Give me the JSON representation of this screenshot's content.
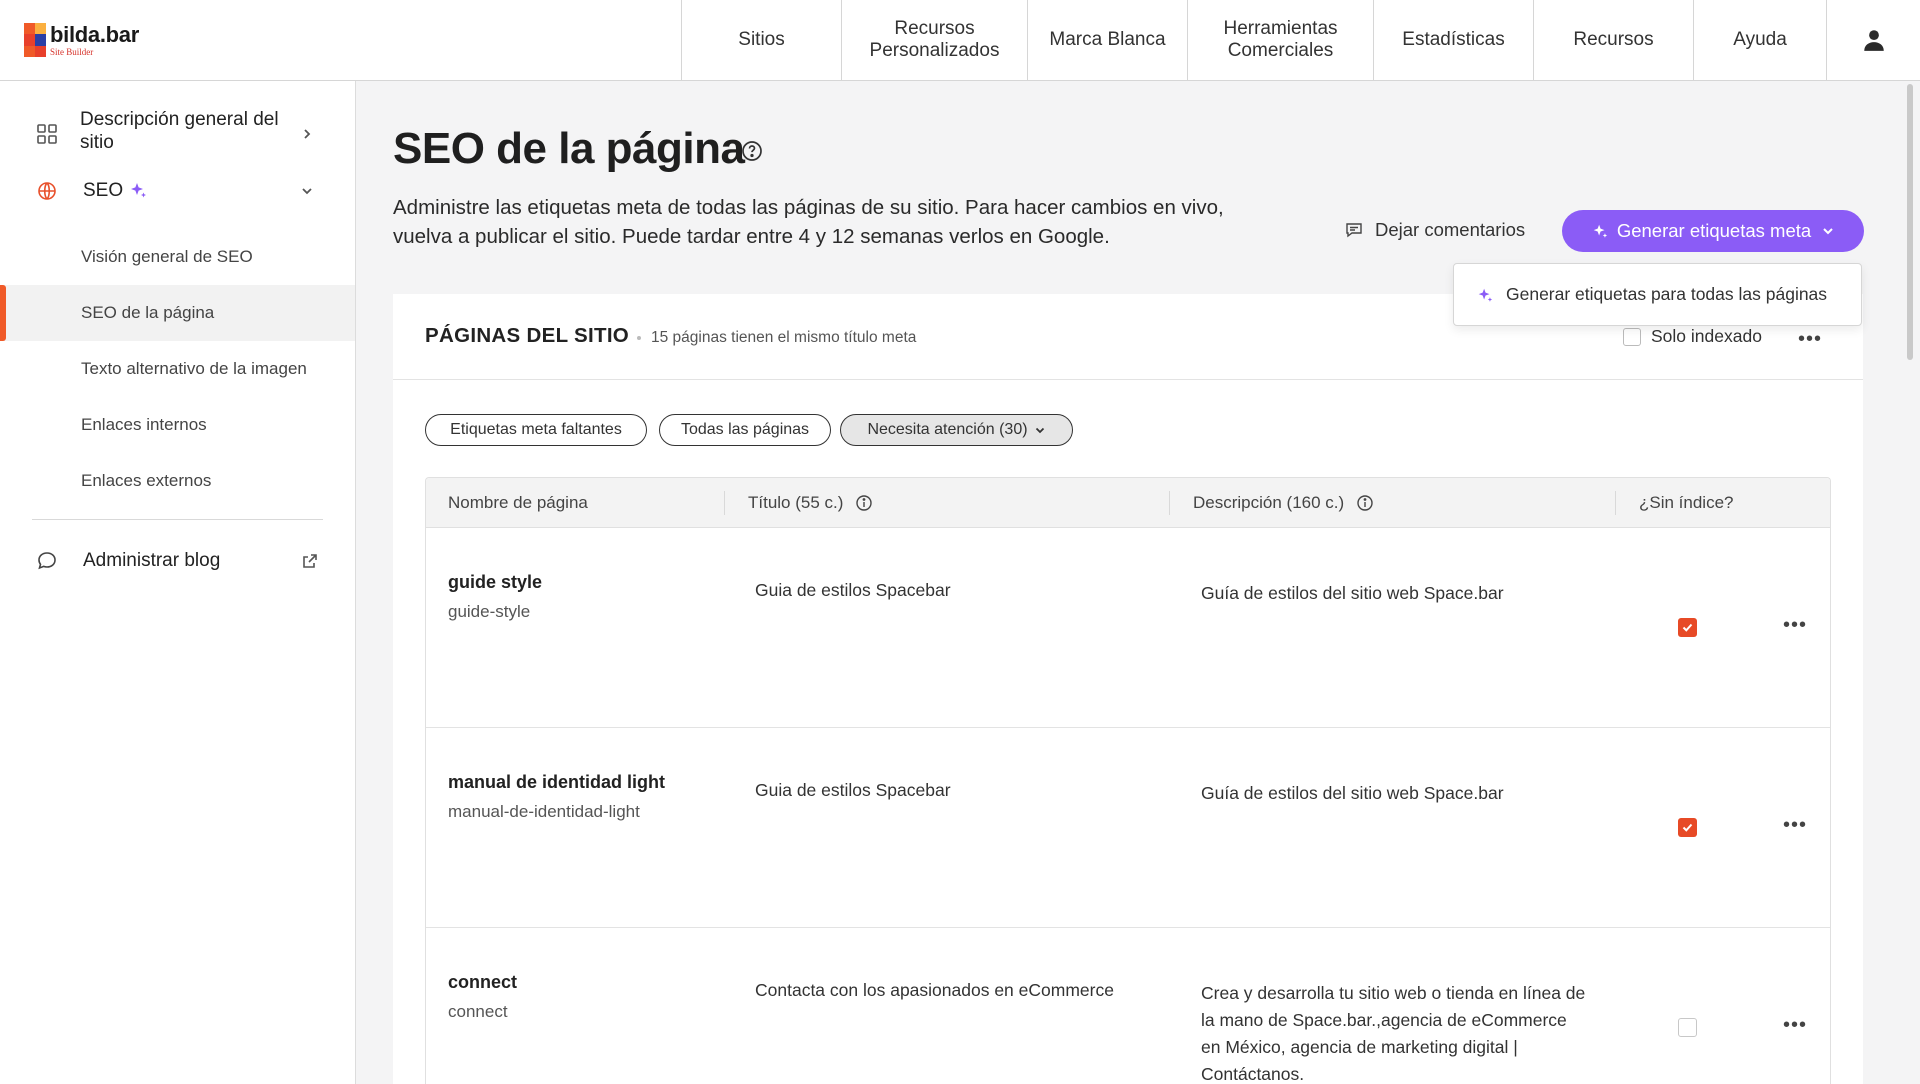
{
  "app": {
    "logo_name": "bilda.bar",
    "logo_sub": "Site Builder"
  },
  "nav": [
    {
      "label": "Sitios"
    },
    {
      "label": "Recursos Personalizados"
    },
    {
      "label": "Marca Blanca"
    },
    {
      "label": "Herramientas Comerciales"
    },
    {
      "label": "Estadísticas"
    },
    {
      "label": "Recursos"
    },
    {
      "label": "Ayuda"
    }
  ],
  "sidebar": {
    "overview_label": "Descripción general del sitio",
    "seo_label": "SEO",
    "seo_sub": [
      {
        "label": "Visión general de SEO"
      },
      {
        "label": "SEO de la página"
      },
      {
        "label": "Texto alternativo de la imagen"
      },
      {
        "label": "Enlaces internos"
      },
      {
        "label": "Enlaces externos"
      }
    ],
    "blog_label": "Administrar blog"
  },
  "page": {
    "title": "SEO de la página",
    "description": "Administre las etiquetas meta de todas las páginas de su sitio. Para hacer cambios en vivo, vuelva a publicar el sitio. Puede tardar entre 4 y 12 semanas verlos en Google.",
    "feedback_label": "Dejar comentarios",
    "generate_label": "Generar etiquetas meta",
    "dropdown_item": "Generar etiquetas para todas las páginas"
  },
  "card": {
    "title": "PÁGINAS DEL SITIO",
    "subtitle": "15 páginas tienen el mismo título meta",
    "indexed_label": "Solo indexado",
    "filters": [
      {
        "label": "Etiquetas meta faltantes"
      },
      {
        "label": "Todas las páginas"
      },
      {
        "label": "Necesita atención (30)"
      }
    ]
  },
  "table": {
    "headers": {
      "name": "Nombre de página",
      "title": "Título (55 c.)",
      "description": "Descripción (160 c.)",
      "noindex": "¿Sin índice?"
    },
    "rows": [
      {
        "name": "guide style",
        "slug": "guide-style",
        "title": "Guia de estilos Spacebar",
        "description": "Guía de estilos del sitio web Space.bar",
        "noindex": true
      },
      {
        "name": "manual de identidad light",
        "slug": "manual-de-identidad-light",
        "title": "Guia de estilos Spacebar",
        "description": "Guía de estilos del sitio web Space.bar",
        "noindex": true
      },
      {
        "name": "connect",
        "slug": "connect",
        "title": "Contacta con los apasionados en eCommerce",
        "description": "Crea y desarrolla tu sitio web o tienda en línea de la mano de Space.bar.,agencia de eCommerce en México, agencia de marketing digital | Contáctanos.",
        "noindex": false
      }
    ]
  },
  "colors": {
    "accent_purple": "#8b5cf6",
    "accent_orange": "#f05a28",
    "checkbox_red": "#e74a26"
  }
}
